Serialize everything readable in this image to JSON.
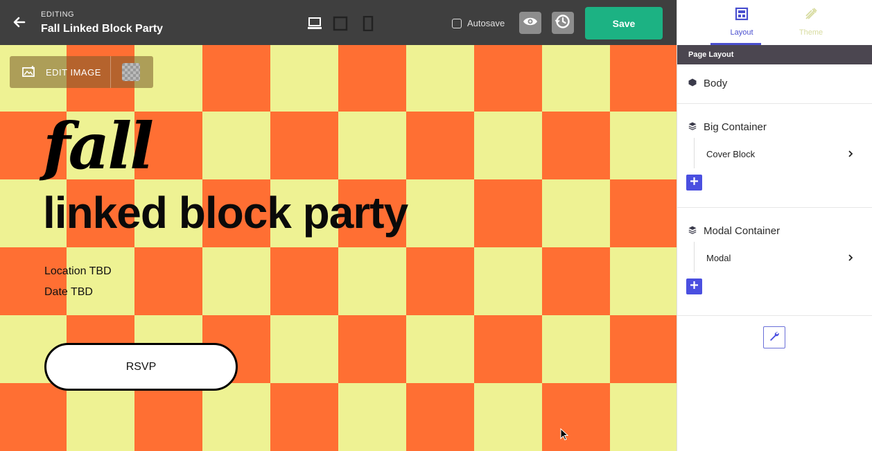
{
  "header": {
    "editing_label": "EDITING",
    "title": "Fall Linked Block Party",
    "autosave_label": "Autosave",
    "autosave_checked": false,
    "save_label": "Save",
    "devices": [
      "desktop-icon",
      "tablet-icon",
      "mobile-icon"
    ],
    "active_device": "desktop"
  },
  "canvas": {
    "edit_image_label": "EDIT IMAGE",
    "script_title": "fall",
    "title": "linked block party",
    "location": "Location TBD",
    "date": "Date TBD",
    "rsvp_label": "RSVP",
    "colors": {
      "orange": "#ff6f33",
      "yellow": "#eef293"
    }
  },
  "panel": {
    "tabs": [
      {
        "label": "Layout",
        "active": true
      },
      {
        "label": "Theme",
        "active": false
      }
    ],
    "section_title": "Page Layout",
    "tree": {
      "body": "Body",
      "big_container": {
        "label": "Big Container",
        "children": [
          "Cover Block"
        ]
      },
      "modal_container": {
        "label": "Modal Container",
        "children": [
          "Modal"
        ]
      }
    },
    "accent": "#4a4fe0"
  }
}
